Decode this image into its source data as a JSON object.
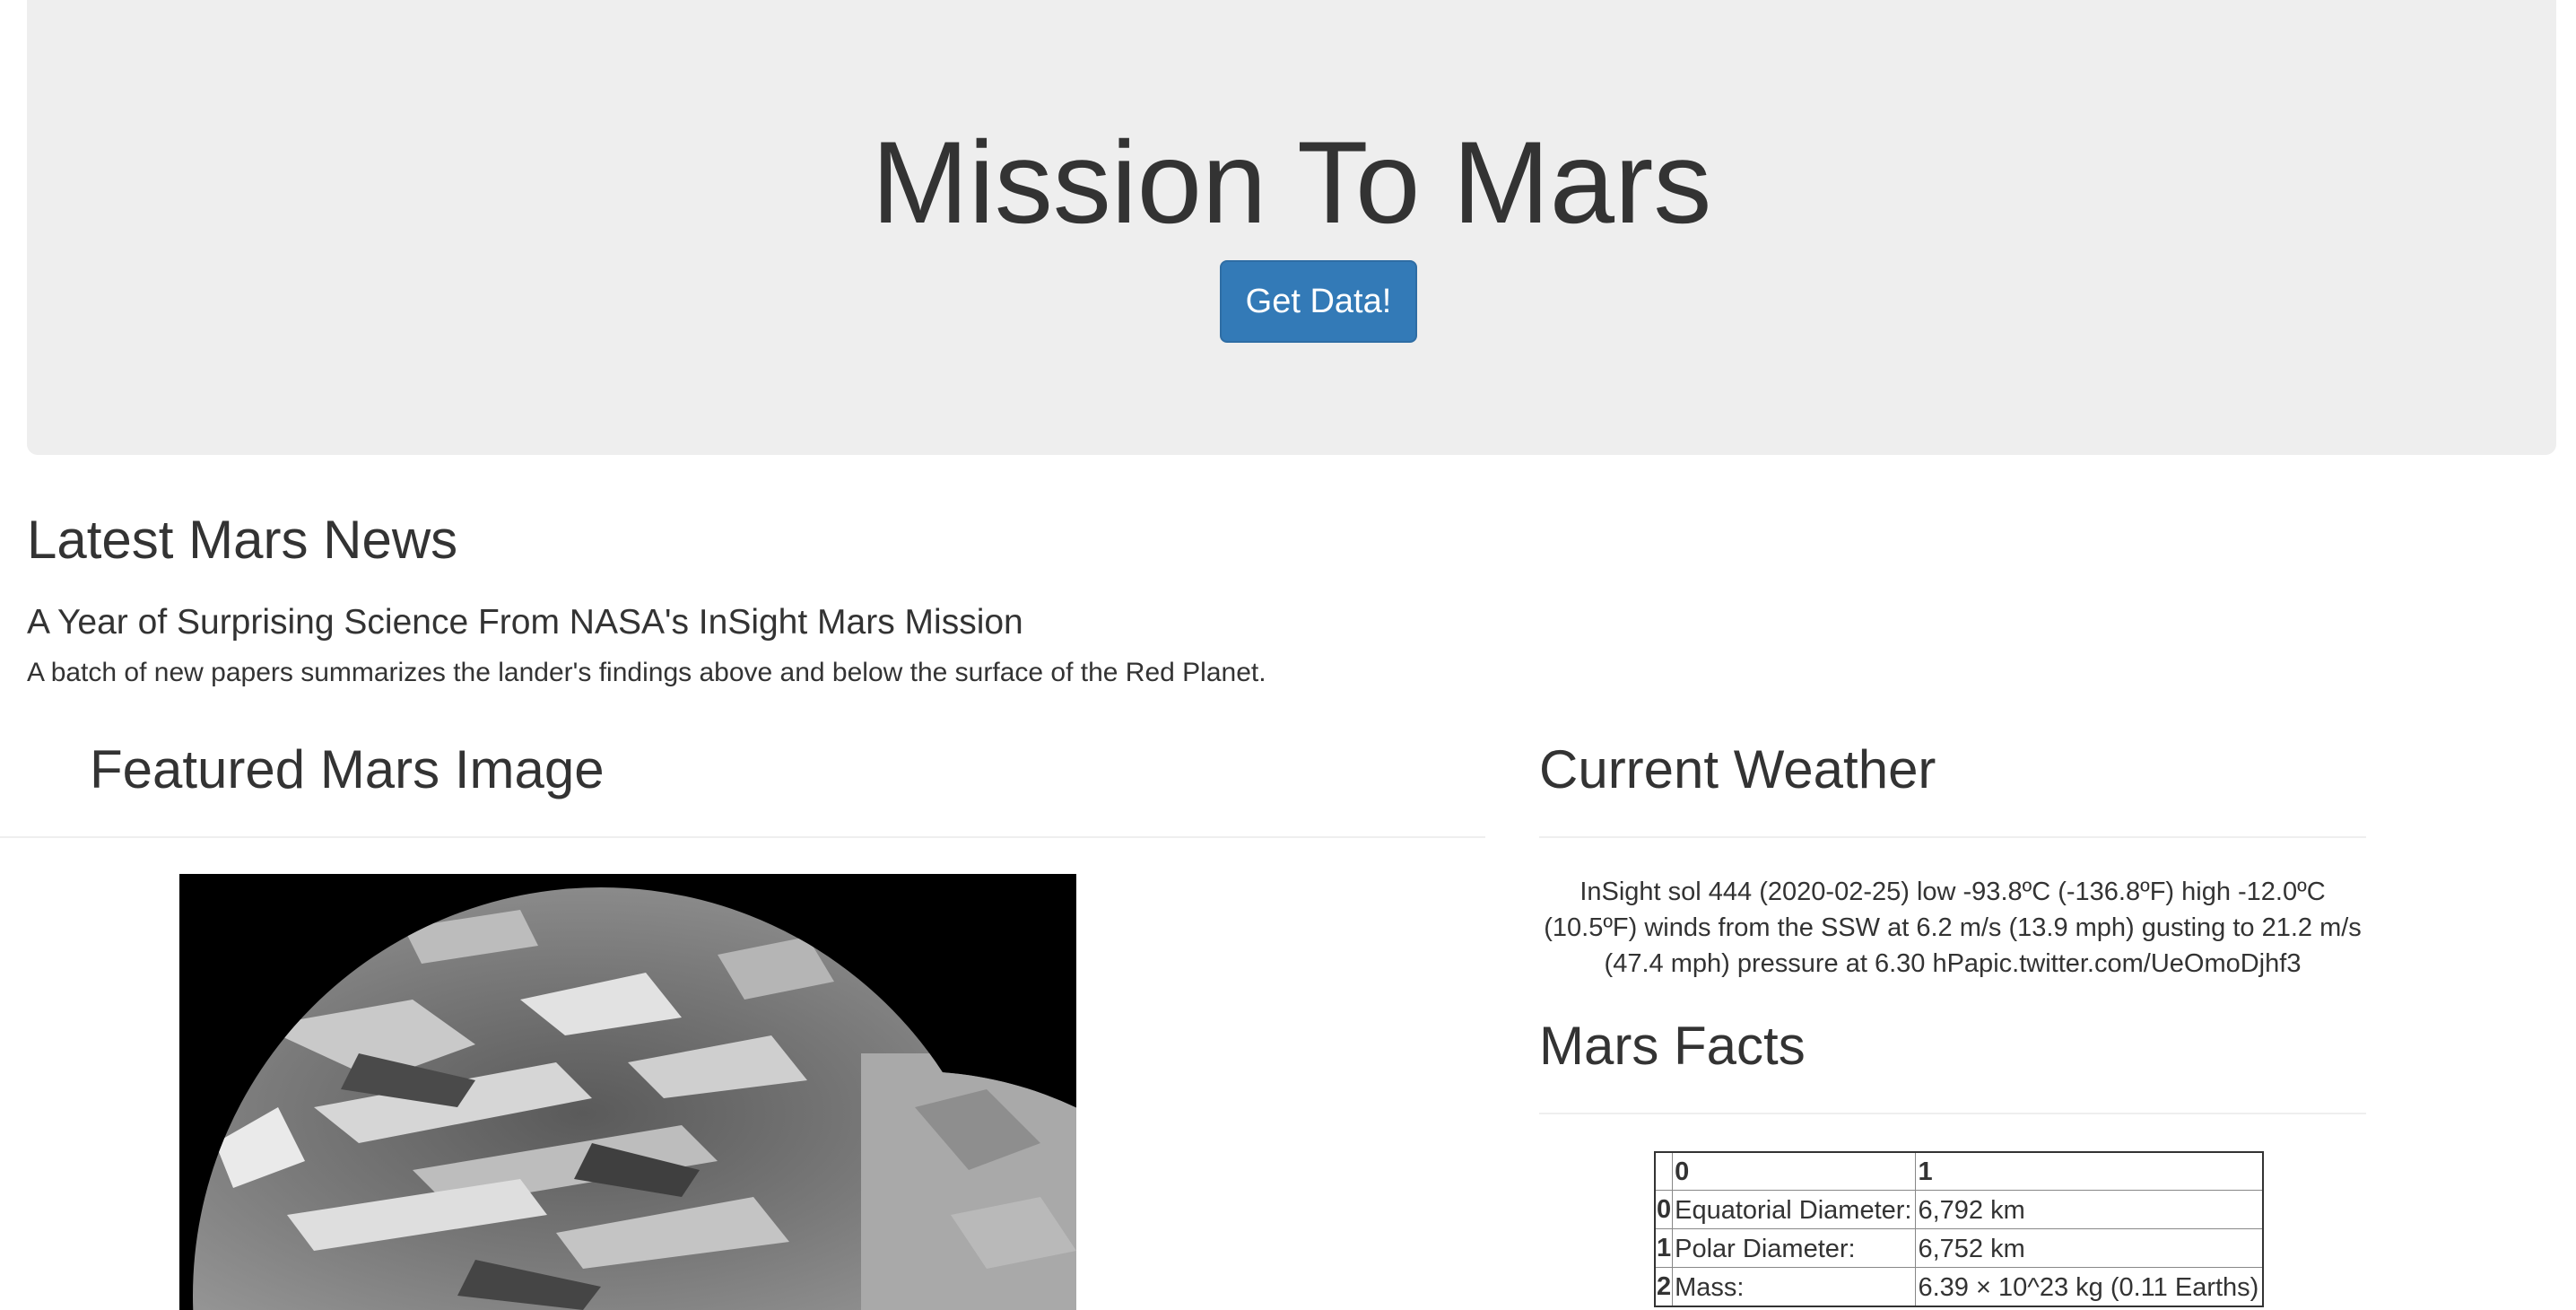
{
  "header": {
    "title": "Mission To Mars",
    "button_label": "Get Data!"
  },
  "news": {
    "heading": "Latest Mars News",
    "title": "A Year of Surprising Science From NASA's InSight Mars Mission",
    "teaser": "A batch of new papers summarizes the lander's findings above and below the surface of the Red Planet."
  },
  "featured": {
    "heading": "Featured Mars Image",
    "image_icon": "mars-surface-image"
  },
  "weather": {
    "heading": "Current Weather",
    "text": "InSight sol 444 (2020-02-25) low -93.8ºC (-136.8ºF) high -12.0ºC (10.5ºF) winds from the SSW at 6.2 m/s (13.9 mph) gusting to 21.2 m/s (47.4 mph) pressure at 6.30 hPapic.twitter.com/UeOmoDjhf3"
  },
  "facts": {
    "heading": "Mars Facts",
    "columns": [
      "",
      "0",
      "1"
    ],
    "rows": [
      {
        "index": "0",
        "label": "Equatorial Diameter:",
        "value": "6,792 km"
      },
      {
        "index": "1",
        "label": "Polar Diameter:",
        "value": "6,752 km"
      },
      {
        "index": "2",
        "label": "Mass:",
        "value": "6.39 × 10^23 kg (0.11 Earths)"
      }
    ]
  },
  "colors": {
    "jumbotron_bg": "#eeeeee",
    "button_primary": "#337ab7",
    "text": "#333333"
  }
}
